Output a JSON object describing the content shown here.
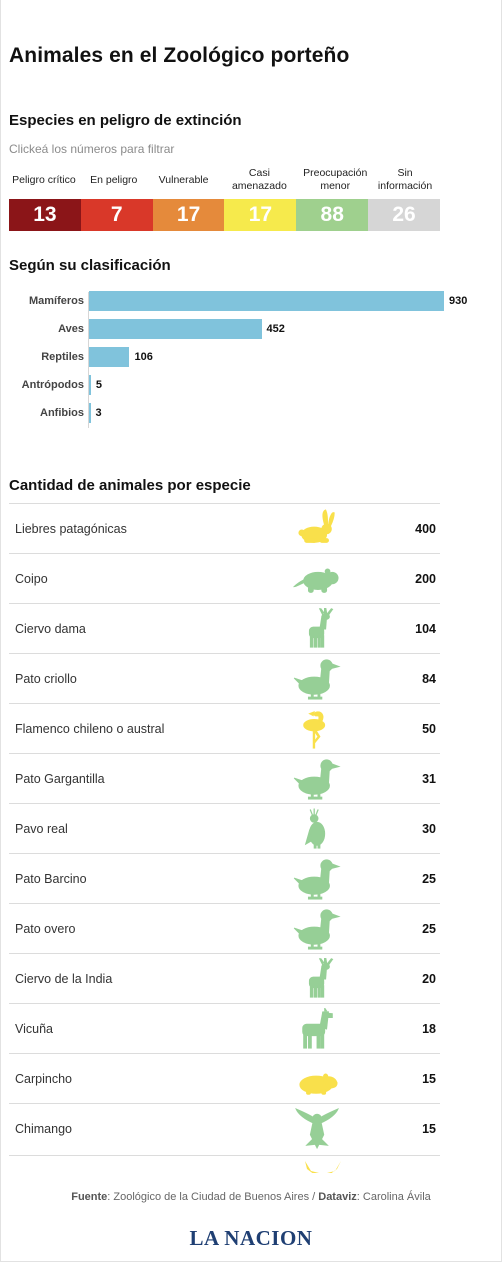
{
  "page": {
    "title": "Animales en el Zoológico porteño"
  },
  "risk": {
    "heading": "Especies en peligro de extinción",
    "hint": "Clickeá los números para filtrar",
    "categories": [
      {
        "label": "Peligro crítico",
        "value": "13",
        "color": "#8b1518"
      },
      {
        "label": "En peligro",
        "value": "7",
        "color": "#d93829"
      },
      {
        "label": "Vulnerable",
        "value": "17",
        "color": "#e58a3b"
      },
      {
        "label": "Casi amenazado",
        "value": "17",
        "color": "#f6ea4c"
      },
      {
        "label": "Preocupación menor",
        "value": "88",
        "color": "#9fd08e"
      },
      {
        "label": "Sin información",
        "value": "26",
        "color": "#d6d6d6"
      }
    ]
  },
  "chart_data": {
    "type": "bar",
    "orientation": "horizontal",
    "title": "Según su clasificación",
    "categories": [
      "Mamíferos",
      "Aves",
      "Reptiles",
      "Antrópodos",
      "Anfibios"
    ],
    "values": [
      930,
      452,
      106,
      5,
      3
    ],
    "xlim": [
      0,
      930
    ],
    "color": "#80c3dc",
    "grid": false
  },
  "species": {
    "heading": "Cantidad de animales por especie",
    "rows": [
      {
        "name": "Liebres patagónicas",
        "value": "400",
        "icon": "hare-icon",
        "color": "#f9e04b"
      },
      {
        "name": "Coipo",
        "value": "200",
        "icon": "coypu-icon",
        "color": "#96cf96"
      },
      {
        "name": "Ciervo dama",
        "value": "104",
        "icon": "deer-icon",
        "color": "#96cf96"
      },
      {
        "name": "Pato criollo",
        "value": "84",
        "icon": "duck-icon",
        "color": "#96cf96"
      },
      {
        "name": "Flamenco chileno o austral",
        "value": "50",
        "icon": "flamingo-icon",
        "color": "#f9e04b"
      },
      {
        "name": "Pato Gargantilla",
        "value": "31",
        "icon": "duck-icon",
        "color": "#96cf96"
      },
      {
        "name": "Pavo real",
        "value": "30",
        "icon": "peacock-icon",
        "color": "#96cf96"
      },
      {
        "name": "Pato Barcino",
        "value": "25",
        "icon": "duck-icon",
        "color": "#96cf96"
      },
      {
        "name": "Pato overo",
        "value": "25",
        "icon": "duck-icon",
        "color": "#96cf96"
      },
      {
        "name": "Ciervo de la India",
        "value": "20",
        "icon": "deer-icon",
        "color": "#96cf96"
      },
      {
        "name": "Vicuña",
        "value": "18",
        "icon": "vicuna-icon",
        "color": "#96cf96"
      },
      {
        "name": "Carpincho",
        "value": "15",
        "icon": "capybara-icon",
        "color": "#f9e04b"
      },
      {
        "name": "Chimango",
        "value": "15",
        "icon": "eagle-icon",
        "color": "#96cf96"
      }
    ],
    "cut_icon_color": "#f9e04b"
  },
  "footer": {
    "source_label": "Fuente",
    "source_text": ": Zoológico de la Ciudad de Buenos Aires / ",
    "dataviz_label": "Dataviz",
    "dataviz_text": ": Carolina Ávila",
    "logo": "LA NACION"
  }
}
